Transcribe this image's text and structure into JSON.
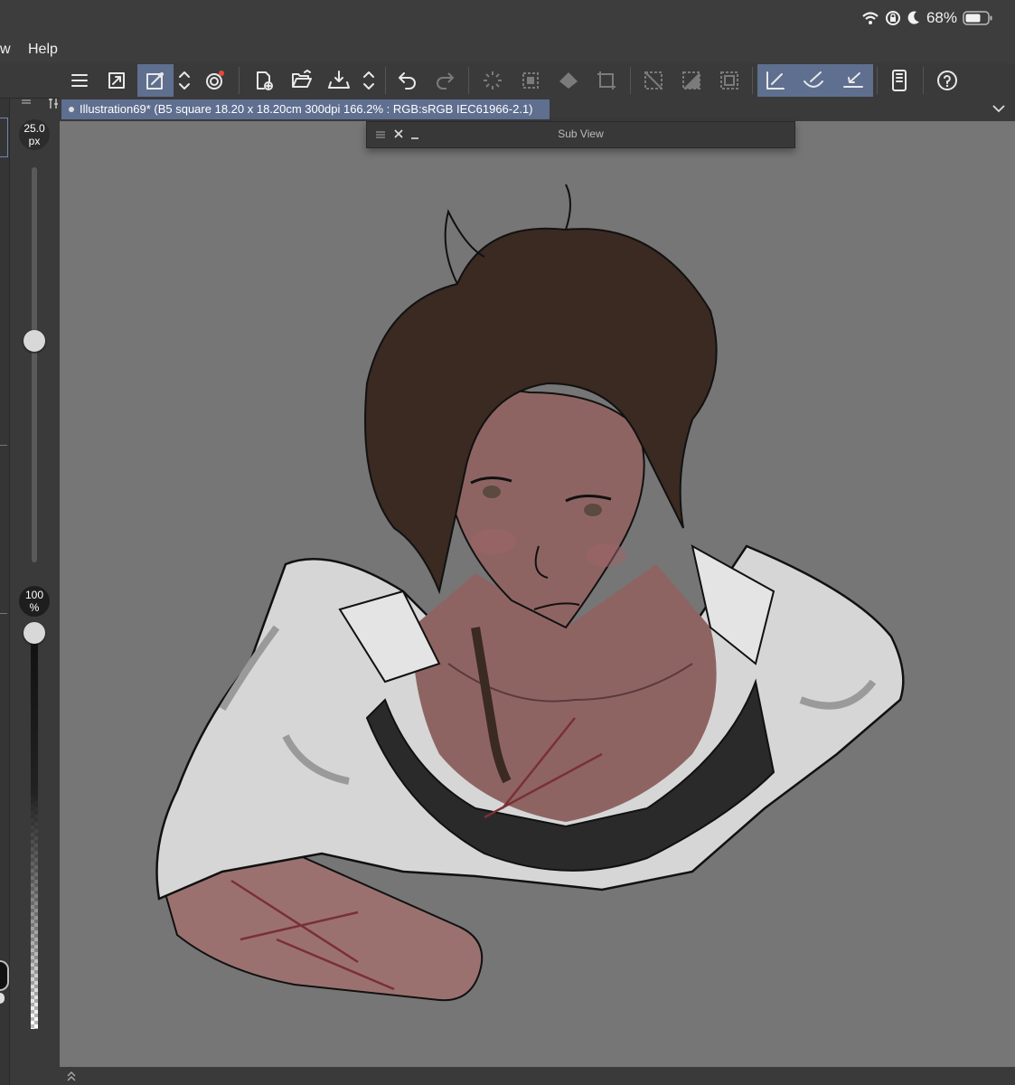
{
  "status_bar": {
    "battery_percent": "68%",
    "battery_level": 0.68
  },
  "menu": {
    "partial_item": "w",
    "help": "Help"
  },
  "toolbar": {
    "buttons": [
      "menu-icon",
      "fit-window-icon",
      "eyedropper-icon",
      "stepper-icon",
      "rotate-icon",
      "new-file-icon",
      "open-folder-icon",
      "save-icon",
      "stepper-icon",
      "undo-icon",
      "redo-icon",
      "loading-icon",
      "select-all-icon",
      "fill-icon",
      "transform-icon",
      "deselect-icon",
      "invert-icon",
      "border-icon",
      "pen-tool-icon",
      "brush-tool-icon",
      "ruler-tool-icon",
      "device-icon",
      "help-icon"
    ]
  },
  "brush": {
    "size_value": "25.0",
    "size_unit": "px",
    "size_level": 0.55
  },
  "opacity": {
    "value": "100",
    "unit": "%",
    "level": 1.0
  },
  "document": {
    "tab_title": "Illustration69* (B5 square 18.20 x 18.20cm 300dpi 166.2% : RGB:sRGB IEC61966-2.1)"
  },
  "subview": {
    "title": "Sub View"
  },
  "colors": {
    "accent": "#5f6f8f",
    "canvas_bg": "#767676",
    "chrome": "#3a3a3a"
  }
}
